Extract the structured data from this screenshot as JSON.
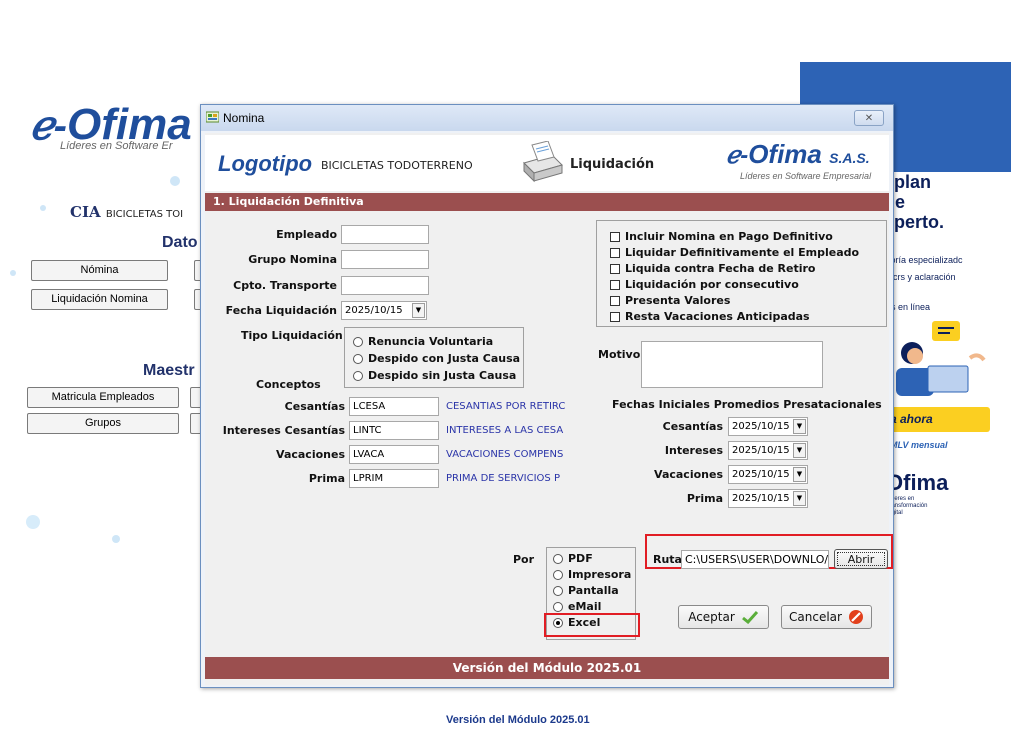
{
  "background": {
    "logo_text": "Ofima",
    "logo_sub": "Líderes en Software Er",
    "cia_label": "CIA",
    "cia_company": "BICICLETAS TOI",
    "datos_title": "Dato",
    "buttons_row1": [
      "Nómina",
      "Liquidación Nomina"
    ],
    "maestros_title": "Maestr",
    "maestros_buttons": [
      "Matricula Empleados",
      "Grupos"
    ],
    "version": "Versión del Módulo 2025.01"
  },
  "ad": {
    "headline_lines": [
      "l plan",
      "de",
      "xperto."
    ],
    "line1": "soría especializadc",
    "line2": "incrs y aclaración",
    "line3": "os en línea",
    "cta": "ta ahora",
    "smlv": "SMLV mensual",
    "brand": "Ofima",
    "brand_sub": "Líderes en Transformación Digital"
  },
  "dialog": {
    "title": "Nomina",
    "close_glyph": "✕",
    "header": {
      "logotipo": "Logotipo",
      "company": "BICICLETAS TODOTERRENO",
      "module": "Liquidación",
      "brand": "Ofima",
      "brand_suffix": "S.A.S.",
      "brand_sub": "Líderes en Software Empresarial"
    },
    "section_title": "1. Liquidación Definitiva",
    "fields": {
      "empleado_label": "Empleado",
      "empleado_value": "",
      "grupo_label": "Grupo Nomina",
      "grupo_value": "",
      "transporte_label": "Cpto. Transporte",
      "transporte_value": "",
      "fecha_label": "Fecha Liquidación",
      "fecha_value": "2025/10/15",
      "tipo_label": "Tipo Liquidación"
    },
    "tipo_options": [
      "Renuncia Voluntaria",
      "Despido con Justa Causa",
      "Despido sin Justa Causa"
    ],
    "checkboxes": [
      "Incluir Nomina en Pago Definitivo",
      "Liquidar Definitivamente  el  Empleado",
      "Liquida contra Fecha de Retiro",
      "Liquidación por consecutivo",
      "Presenta Valores",
      "Resta Vacaciones Anticipadas"
    ],
    "motivo_label": "Motivo",
    "conceptos_label": "Conceptos",
    "conceptos": [
      {
        "label": "Cesantías",
        "code": "LCESA",
        "desc": "CESANTIAS POR RETIRC"
      },
      {
        "label": "Intereses Cesantías",
        "code": "LINTC",
        "desc": "INTERESES A LAS CESA"
      },
      {
        "label": "Vacaciones",
        "code": "LVACA",
        "desc": "VACACIONES COMPENS"
      },
      {
        "label": "Prima",
        "code": "LPRIM",
        "desc": "PRIMA DE SERVICIOS P"
      }
    ],
    "fechas_title": "Fechas Iniciales Promedios Presatacionales",
    "fechas": [
      {
        "label": "Cesantías",
        "value": "2025/10/15"
      },
      {
        "label": "Intereses",
        "value": "2025/10/15"
      },
      {
        "label": "Vacaciones",
        "value": "2025/10/15"
      },
      {
        "label": "Prima",
        "value": "2025/10/15"
      }
    ],
    "por_label": "Por",
    "output_options": [
      "PDF",
      "Impresora",
      "Pantalla",
      "eMail",
      "Excel"
    ],
    "selected_output": "Excel",
    "ruta_label": "Ruta",
    "ruta_value": "C:\\USERS\\USER\\DOWNLO/",
    "abrir_label": "Abrir",
    "aceptar_label": "Aceptar",
    "cancelar_label": "Cancelar",
    "footer": "Versión del Módulo 2025.01",
    "colors": {
      "section_bar": "#9b4f4f",
      "highlight": "#e11d24",
      "desc_text": "#2a34a8"
    }
  }
}
